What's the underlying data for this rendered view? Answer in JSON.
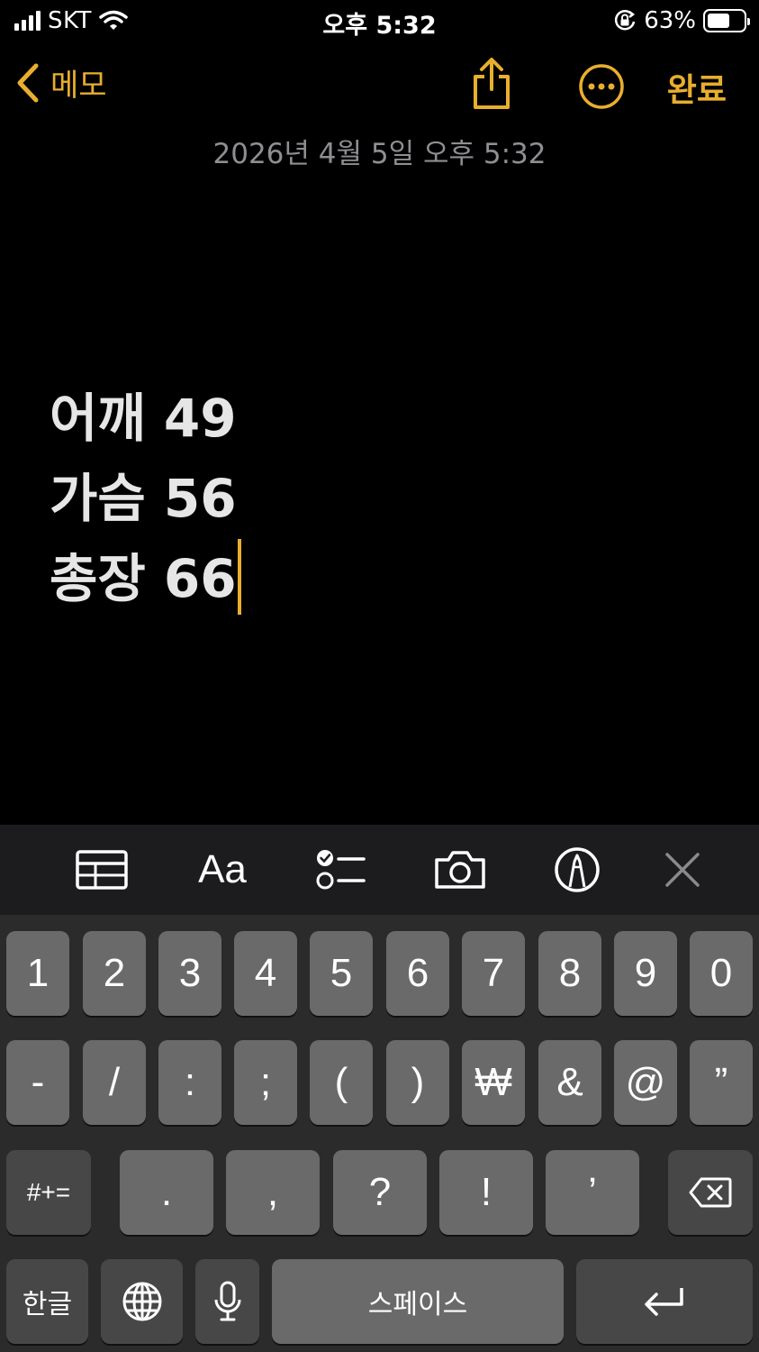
{
  "status_bar": {
    "carrier": "SKT",
    "time": "오후 5:32",
    "battery_percent": "63%",
    "battery_level": 0.63,
    "icons": [
      "signal-icon",
      "wifi-icon",
      "orientation-lock-icon",
      "battery-icon"
    ]
  },
  "nav": {
    "back_label": "메모",
    "done_label": "완료",
    "icons": [
      "chevron-left-icon",
      "share-icon",
      "more-icon"
    ]
  },
  "note": {
    "date": "2026년 4월 5일 오후 5:32",
    "lines": [
      "어깨 49",
      "가슴 56",
      "총장 66"
    ]
  },
  "toolbar": {
    "format_label": "Aa",
    "icons": [
      "table-icon",
      "format-icon",
      "checklist-icon",
      "camera-icon",
      "markup-icon",
      "close-icon"
    ]
  },
  "keyboard": {
    "row1": [
      "1",
      "2",
      "3",
      "4",
      "5",
      "6",
      "7",
      "8",
      "9",
      "0"
    ],
    "row2": [
      "-",
      "/",
      ":",
      ";",
      "(",
      ")",
      "₩",
      "&",
      "@",
      "”"
    ],
    "row3": [
      ".",
      ",",
      "?",
      "!",
      "’"
    ],
    "symbols_label": "#+=",
    "hangul_label": "한글",
    "space_label": "스페이스"
  },
  "colors": {
    "accent": "#E8AE2E",
    "background": "#000000",
    "toolbar_bg": "#1C1C1E",
    "keyboard_bg": "#2B2B2B",
    "key_bg": "#6A6A6A",
    "key_dark_bg": "#474747",
    "date_text": "#8E8E93"
  }
}
